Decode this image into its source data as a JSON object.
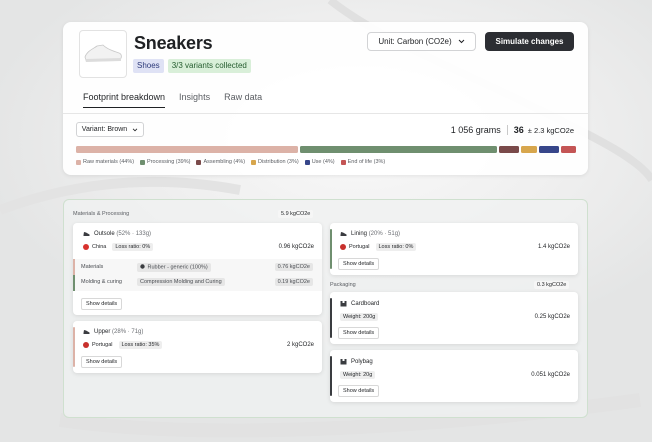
{
  "product": {
    "name": "Sneakers",
    "category": "Shoes",
    "variants_collected": "3/3 variants collected"
  },
  "header": {
    "unit_label": "Unit: Carbon (CO2e)",
    "simulate_label": "Simulate changes"
  },
  "tabs": [
    {
      "label": "Footprint breakdown",
      "active": true
    },
    {
      "label": "Insights",
      "active": false
    },
    {
      "label": "Raw data",
      "active": false
    }
  ],
  "variant_selector": "Variant: Brown",
  "totals": {
    "grams": "1 056 grams",
    "co2": "36",
    "co2_unit": "± 2.3 kgCO2e"
  },
  "stages": [
    {
      "label": "Raw materials (44%)",
      "share": 44,
      "color": "#dcb2a7"
    },
    {
      "label": "Processing (39%)",
      "share": 39,
      "color": "#6f8f6f"
    },
    {
      "label": "Assembling (4%)",
      "share": 4,
      "color": "#7a4a4a"
    },
    {
      "label": "Distribution (3%)",
      "share": 3,
      "color": "#d7a64d"
    },
    {
      "label": "Use (4%)",
      "share": 4,
      "color": "#37468a"
    },
    {
      "label": "End of life (3%)",
      "share": 3,
      "color": "#c45555"
    }
  ],
  "materials_processing": {
    "label": "Materials & Processing",
    "value": "5.9 kgCO2e"
  },
  "outsole": {
    "title": "Outsole",
    "detail": "(52% · 133g)",
    "country": "China",
    "loss": "Loss ratio: 0%",
    "value": "0.96 kgCO2e",
    "materials_label": "Materials",
    "materials_tag": "Rubber - generic (100%)",
    "materials_value": "0.76 kgCO2e",
    "molding_label": "Molding & curing",
    "molding_tag": "Compression Molding and Curing",
    "molding_value": "0.19 kgCO2e",
    "details_button": "Show details"
  },
  "upper": {
    "title": "Upper",
    "detail": "(28% · 71g)",
    "country": "Portugal",
    "loss": "Loss ratio: 35%",
    "value": "2 kgCO2e",
    "details_button": "Show details"
  },
  "lining": {
    "title": "Lining",
    "detail": "(20% · 51g)",
    "country": "Portugal",
    "loss": "Loss ratio: 0%",
    "value": "1.4 kgCO2e",
    "details_button": "Show details"
  },
  "packaging": {
    "label": "Packaging",
    "value": "0.3 kgCO2e"
  },
  "cardboard": {
    "title": "Cardboard",
    "weight": "Weight: 200g",
    "value": "0.25 kgCO2e",
    "details_button": "Show details"
  },
  "polybag": {
    "title": "Polybag",
    "weight": "Weight: 20g",
    "value": "0.051 kgCO2e",
    "details_button": "Show details"
  },
  "colors": {
    "china_flag": "#d8322e",
    "portugal_flag": "#c8302c",
    "raw_accent": "#dcb2a7",
    "processing_accent": "#6f8f6f",
    "packaging_accent": "#3a3c40"
  },
  "icons": {
    "shoe_part": "shoe-icon",
    "box": "box-icon",
    "chevron": "chevron-down-icon"
  }
}
